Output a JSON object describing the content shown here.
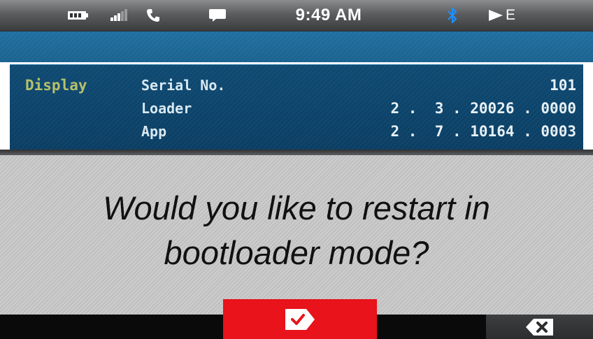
{
  "status_bar": {
    "time": "9:49 AM",
    "network": "E",
    "icons": [
      "battery-icon",
      "signal-icon",
      "phone-icon",
      "message-icon",
      "bluetooth-icon",
      "network-arrow-icon"
    ]
  },
  "info": {
    "label": "Display",
    "rows": [
      {
        "key": "Serial No.",
        "value": "101"
      },
      {
        "key": "Loader",
        "value": "2 .  3 . 20026 . 0000"
      },
      {
        "key": "App",
        "value": "2 .  7 . 10164 . 0003"
      }
    ]
  },
  "dialog": {
    "message": "Would you like to restart in bootloader mode?"
  },
  "buttons": {
    "confirm_icon": "checkmark-tag-icon",
    "cancel_icon": "cancel-delete-icon"
  },
  "colors": {
    "status_bar": "#5b5d5e",
    "header_blue": "#1f6fa1",
    "panel_blue": "#0e4a73",
    "label_olive": "#b7c06a",
    "dialog_gray": "#c9c9c9",
    "confirm_red": "#e8131b",
    "bluetooth_blue": "#1e90ff"
  }
}
